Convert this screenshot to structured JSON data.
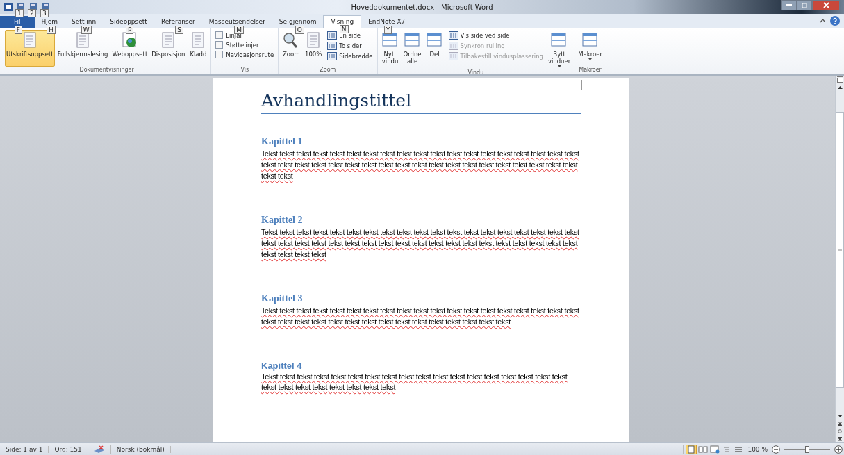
{
  "window": {
    "title": "Hoveddokumentet.docx - Microsoft Word"
  },
  "quick_access": [
    {
      "keytip": "1"
    },
    {
      "keytip": "2"
    },
    {
      "keytip": "3"
    }
  ],
  "tabs": [
    {
      "label": "Fil",
      "keytip": "F",
      "selected": false,
      "kind": "file"
    },
    {
      "label": "Hjem",
      "keytip": "H",
      "selected": false,
      "kind": "tab"
    },
    {
      "label": "Sett inn",
      "keytip": "W",
      "selected": false,
      "kind": "tab"
    },
    {
      "label": "Sideoppsett",
      "keytip": "P",
      "selected": false,
      "kind": "tab"
    },
    {
      "label": "Referanser",
      "keytip": "S",
      "selected": false,
      "kind": "tab"
    },
    {
      "label": "Masseutsendelser",
      "keytip": "M",
      "selected": false,
      "kind": "tab"
    },
    {
      "label": "Se gjennom",
      "keytip": "O",
      "selected": false,
      "kind": "tab"
    },
    {
      "label": "Visning",
      "keytip": "N",
      "selected": true,
      "kind": "tab"
    },
    {
      "label": "EndNote X7",
      "keytip": "Y",
      "selected": false,
      "kind": "tab"
    }
  ],
  "ribbon": [
    {
      "label": "Dokumentvisninger",
      "items": [
        {
          "kind": "large",
          "label": "Utskriftsoppsett",
          "selected": true
        },
        {
          "kind": "large",
          "label": "Fullskjermslesing",
          "selected": false
        },
        {
          "kind": "large",
          "label": "Weboppsett",
          "selected": false
        },
        {
          "kind": "large",
          "label": "Disposisjon",
          "selected": false
        },
        {
          "kind": "large",
          "label": "Kladd",
          "selected": false
        }
      ]
    },
    {
      "label": "Vis",
      "items": [
        {
          "kind": "stack",
          "items": [
            {
              "kind": "check",
              "label": "Linjal",
              "checked": false
            },
            {
              "kind": "check",
              "label": "Støttelinjer",
              "checked": false
            },
            {
              "kind": "check",
              "label": "Navigasjonsrute",
              "checked": false
            }
          ]
        }
      ]
    },
    {
      "label": "Zoom",
      "items": [
        {
          "kind": "large",
          "label": "Zoom",
          "selected": false
        },
        {
          "kind": "large",
          "label": "100%",
          "selected": false
        },
        {
          "kind": "stack",
          "items": [
            {
              "kind": "small",
              "label": "En side",
              "disabled": false
            },
            {
              "kind": "small",
              "label": "To sider",
              "disabled": false
            },
            {
              "kind": "small",
              "label": "Sidebredde",
              "disabled": false
            }
          ]
        }
      ]
    },
    {
      "label": "Vindu",
      "items": [
        {
          "kind": "large",
          "label": "Nytt vindu",
          "selected": false
        },
        {
          "kind": "large",
          "label": "Ordne alle",
          "selected": false
        },
        {
          "kind": "large",
          "label": "Del",
          "selected": false
        },
        {
          "kind": "stack",
          "items": [
            {
              "kind": "small",
              "label": "Vis side ved side",
              "disabled": false
            },
            {
              "kind": "small",
              "label": "Synkron rulling",
              "disabled": true
            },
            {
              "kind": "small",
              "label": "Tilbakestill vindusplassering",
              "disabled": true
            }
          ]
        },
        {
          "kind": "large",
          "label": "Bytt vinduer",
          "selected": false,
          "dropdown": true
        }
      ]
    },
    {
      "label": "Makroer",
      "items": [
        {
          "kind": "large",
          "label": "Makroer",
          "selected": false,
          "dropdown": true
        }
      ]
    }
  ],
  "document": {
    "title": "Avhandlingstittel",
    "sections": [
      {
        "heading": "Kapittel 1",
        "kind": "serif",
        "spelling_errors": true,
        "text": "Tekst tekst tekst tekst tekst tekst tekst tekst tekst tekst tekst tekst tekst tekst tekst tekst tekst tekst tekst tekst tekst tekst tekst tekst tekst tekst tekst tekst tekst tekst tekst tekst tekst tekst tekst tekst tekst tekst tekst tekst"
      },
      {
        "heading": "Kapittel 2",
        "kind": "serif",
        "spelling_errors": true,
        "text": "Tekst tekst tekst tekst tekst tekst tekst tekst tekst tekst tekst tekst tekst tekst tekst tekst tekst tekst tekst tekst tekst tekst tekst tekst tekst tekst tekst tekst tekst tekst tekst tekst tekst tekst tekst tekst tekst tekst tekst tekst tekst tekst"
      },
      {
        "heading": "Kapittel 3",
        "kind": "serif",
        "spelling_errors": true,
        "text": "Tekst tekst tekst tekst tekst tekst tekst tekst tekst tekst tekst tekst tekst tekst tekst tekst tekst tekst tekst tekst tekst tekst tekst tekst tekst tekst tekst tekst tekst tekst tekst tekst tekst tekst"
      },
      {
        "heading": "Kapittel 4",
        "kind": "sans",
        "spelling_errors": true,
        "text": "Tekst tekst tekst tekst tekst tekst tekst tekst tekst tekst tekst tekst tekst tekst tekst tekst tekst tekst tekst tekst tekst tekst tekst tekst tekst tekst"
      }
    ]
  },
  "status_bar": {
    "page": "Side: 1 av 1",
    "words": "Ord: 151",
    "language": "Norsk (bokmål)",
    "zoom": "100 %",
    "level": 0.5
  }
}
